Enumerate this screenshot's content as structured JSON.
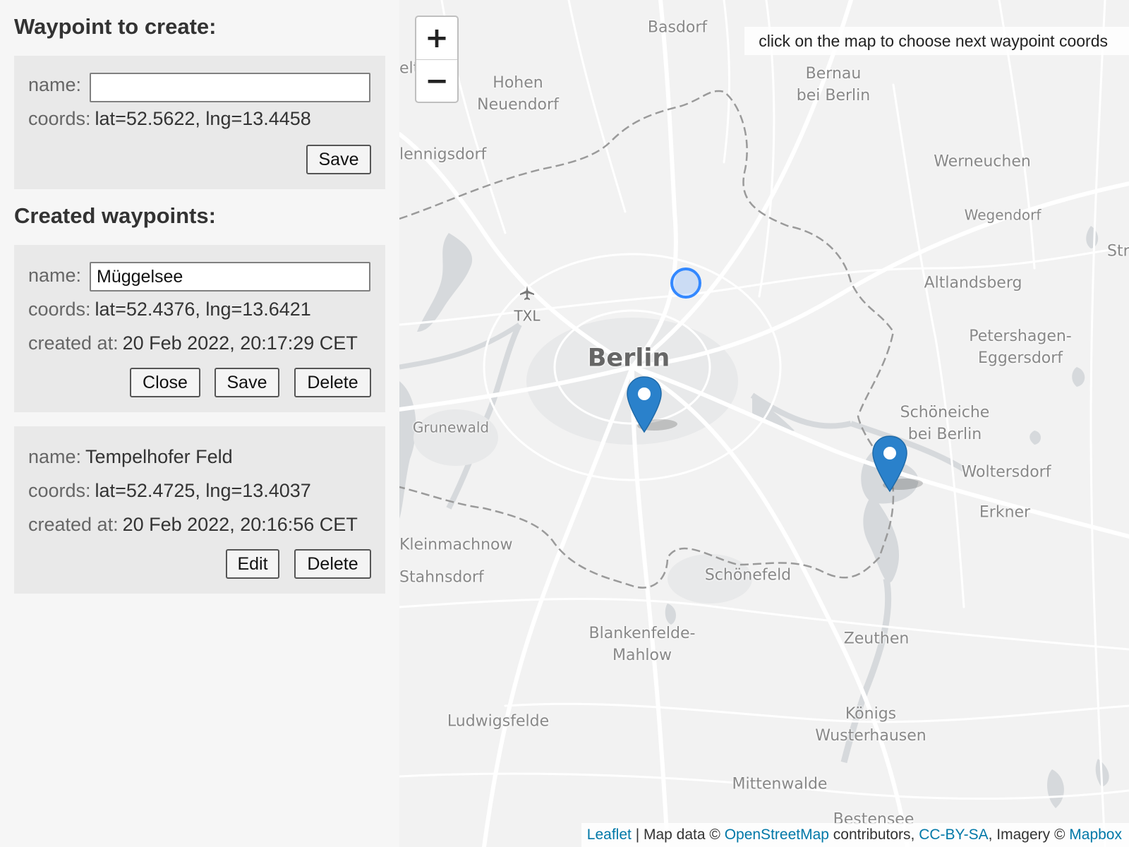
{
  "create": {
    "heading": "Waypoint to create:",
    "name_label": "name:",
    "name_value": "",
    "coords_label": "coords:",
    "coords_value": "lat=52.5622, lng=13.4458",
    "save_label": "Save"
  },
  "created": {
    "heading": "Created waypoints:",
    "items": [
      {
        "name_label": "name:",
        "name_value": "Müggelsee",
        "coords_label": "coords:",
        "coords_value": "lat=52.4376, lng=13.6421",
        "created_label": "created at:",
        "created_value": "20 Feb 2022, 20:17:29 CET",
        "close_label": "Close",
        "save_label": "Save",
        "delete_label": "Delete"
      },
      {
        "name_label": "name:",
        "name_value": "Tempelhofer Feld",
        "coords_label": "coords:",
        "coords_value": "lat=52.4725, lng=13.4037",
        "created_label": "created at:",
        "created_value": "20 Feb 2022, 20:16:56 CET",
        "edit_label": "Edit",
        "delete_label": "Delete"
      }
    ]
  },
  "map": {
    "zoom_in": "+",
    "zoom_out": "−",
    "hint": "click on the map to choose next waypoint coords",
    "airport_code": "TXL",
    "places": {
      "berlin": "Berlin",
      "basdorf": "Basdorf",
      "hohen_neuendorf": "Hohen\nNeuendorf",
      "bernau": "Bernau\nbei Berlin",
      "hennigsdorf": "lennigsdorf",
      "elt": "elt",
      "werneuchen": "Werneuchen",
      "wegendorf": "Wegendorf",
      "strau": "Strau",
      "altlandsberg": "Altlandsberg",
      "petershagen": "Petershagen-\nEggersdorf",
      "schoeneiche": "Schöneiche\nbei Berlin",
      "woltersdorf": "Woltersdorf",
      "erkner": "Erkner",
      "grunewald": "Grunewald",
      "kleinmachnow": "Kleinmachnow",
      "stahnsdorf": "Stahnsdorf",
      "schoenefeld": "Schönefeld",
      "blankenfelde": "Blankenfelde-\nMahlow",
      "zeuthen": "Zeuthen",
      "ludwigsfelde": "Ludwigsfelde",
      "koenigs": "Königs\nWusterhausen",
      "mittenwalde": "Mittenwalde",
      "bestensee": "Bestensee"
    },
    "colors": {
      "marker": "#2a81cb",
      "selection": "#3388ff",
      "link": "#0078a8"
    },
    "attribution": {
      "leaflet": "Leaflet",
      "sep1": " | Map data © ",
      "osm": "OpenStreetMap",
      "sep2": " contributors, ",
      "license": "CC-BY-SA",
      "sep3": ", Imagery © ",
      "mapbox": "Mapbox"
    }
  }
}
